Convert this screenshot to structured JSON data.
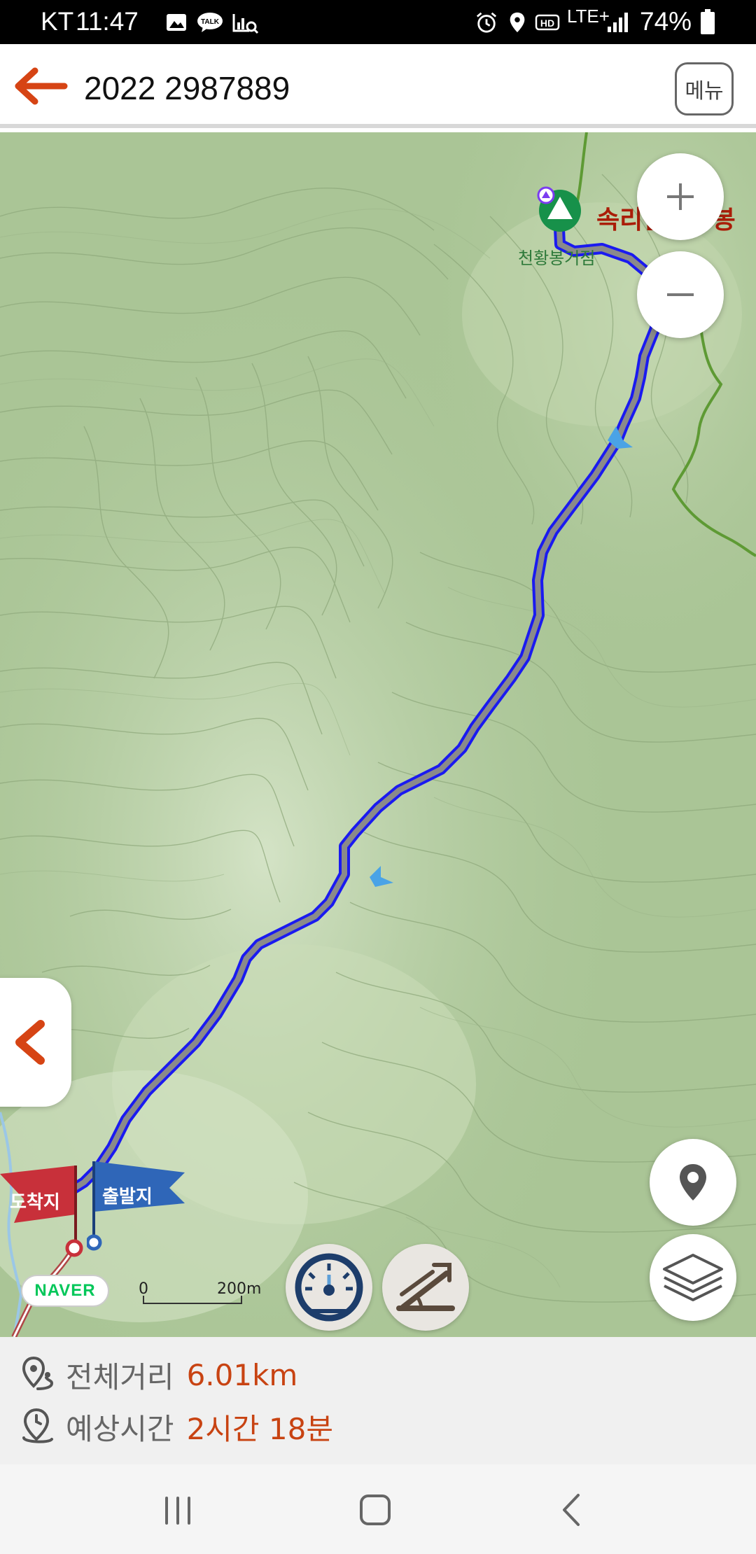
{
  "status_bar": {
    "carrier": "KT",
    "time": "11:47",
    "network": "LTE+",
    "battery": "74%",
    "icons": [
      "gallery-icon",
      "kakaotalk-icon",
      "chart-icon",
      "alarm-icon",
      "location-icon",
      "hd-icon",
      "signal-icon",
      "battery-icon"
    ],
    "talk_label": "TALK",
    "hd_label": "HD"
  },
  "header": {
    "title": "2022 2987889",
    "menu_label": "메뉴"
  },
  "map": {
    "peak_label": "속리산천황봉",
    "hill_label": "천황봉거점",
    "arrival_flag": "도착지",
    "departure_flag": "출발지",
    "provider": "NAVER",
    "scale_start": "0",
    "scale_end": "200m",
    "route_color": "#1a1af0",
    "route_center_color": "#8a8a8a",
    "terrain_color": "#aac596",
    "trail_color": "#5e9a34"
  },
  "route_info": {
    "distance_label": "전체거리",
    "distance_value": "6.01km",
    "time_label": "예상시간",
    "time_value": "2시간 18분",
    "accent": "#c84312"
  }
}
